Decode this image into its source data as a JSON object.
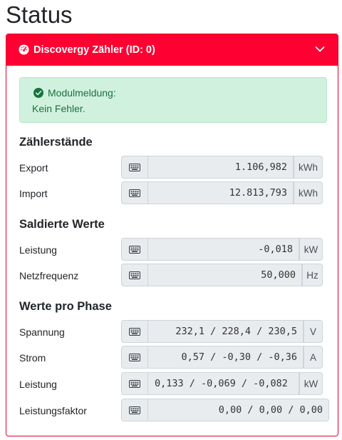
{
  "page": {
    "title": "Status"
  },
  "card": {
    "title": "Discovergy Zähler (ID: 0)",
    "header_color": "#ff0033"
  },
  "alert": {
    "title": "Modulmeldung:",
    "text": "Kein Fehler."
  },
  "sections": {
    "zaehlerstaende": {
      "title": "Zählerstände",
      "rows": [
        {
          "label": "Export",
          "value": "1.106,982",
          "unit": "kWh"
        },
        {
          "label": "Import",
          "value": "12.813,793",
          "unit": "kWh"
        }
      ]
    },
    "saldierte": {
      "title": "Saldierte Werte",
      "rows": [
        {
          "label": "Leistung",
          "value": "-0,018",
          "unit": "kW"
        },
        {
          "label": "Netzfrequenz",
          "value": "50,000",
          "unit": "Hz"
        }
      ]
    },
    "phase": {
      "title": "Werte pro Phase",
      "rows": [
        {
          "label": "Spannung",
          "value": "232,1 / 228,4 / 230,5",
          "unit": "V"
        },
        {
          "label": "Strom",
          "value": "0,57 / -0,30 / -0,36",
          "unit": "A"
        },
        {
          "label": "Leistung",
          "value": "0,133 / -0,069 / -0,082",
          "unit": "kW"
        },
        {
          "label": "Leistungsfaktor",
          "value": "0,00 / 0,00 / 0,00",
          "unit": ""
        }
      ]
    }
  },
  "icons": {
    "header": "tachometer-icon",
    "collapse": "chevron-down-icon",
    "alert": "check-circle-icon",
    "field": "keyboard-icon"
  }
}
